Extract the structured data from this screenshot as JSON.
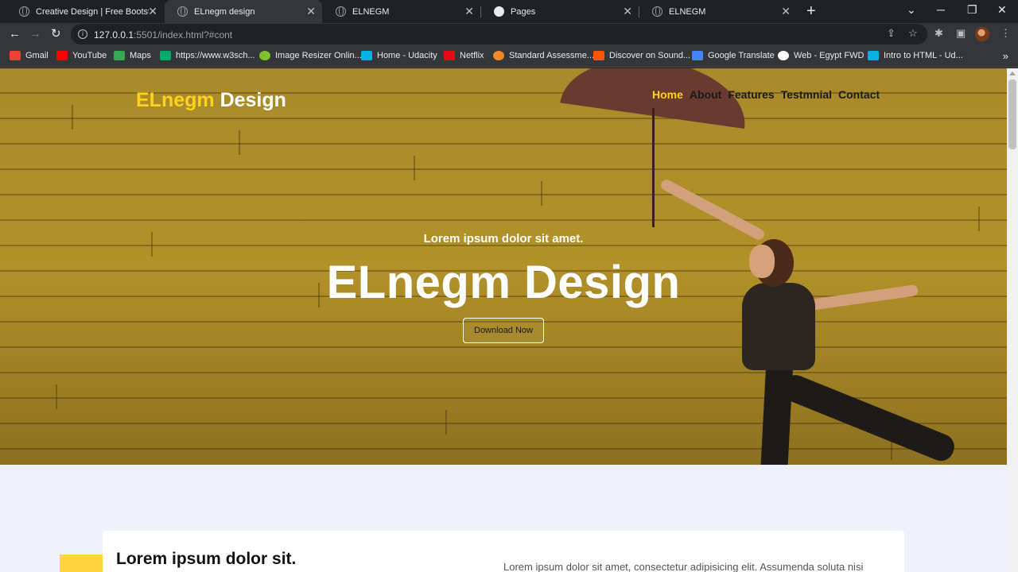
{
  "browser": {
    "tabs": [
      {
        "title": "Creative Design | Free Bootstrap",
        "active": false,
        "icon": "globe-icon"
      },
      {
        "title": "ELnegm design",
        "active": true,
        "icon": "globe-icon"
      },
      {
        "title": "ELNEGM",
        "active": false,
        "icon": "globe-icon"
      },
      {
        "title": "Pages",
        "active": false,
        "icon": "github-icon"
      },
      {
        "title": "ELNEGM",
        "active": false,
        "icon": "globe-icon"
      }
    ],
    "url_host": "127.0.0.1",
    "url_path": ":5501/index.html?#cont",
    "bookmarks": [
      {
        "label": "Gmail",
        "color": "#ea4335"
      },
      {
        "label": "YouTube",
        "color": "#ff0000"
      },
      {
        "label": "Maps",
        "color": "#34a853"
      },
      {
        "label": "https://www.w3sch...",
        "color": "#04aa6d"
      },
      {
        "label": "Image Resizer Onlin...",
        "color": "#7ec12b"
      },
      {
        "label": "Home - Udacity",
        "color": "#02b3e4"
      },
      {
        "label": "Netflix",
        "color": "#e50914"
      },
      {
        "label": "Standard Assessme...",
        "color": "#f08a24"
      },
      {
        "label": "Discover on Sound...",
        "color": "#ff5500"
      },
      {
        "label": "Google Translate",
        "color": "#4285f4"
      },
      {
        "label": "Web - Egypt FWD",
        "color": "#ffffff"
      },
      {
        "label": "Intro to HTML - Ud...",
        "color": "#02b3e4"
      }
    ]
  },
  "page": {
    "logo_accent": "ELnegm",
    "logo_rest": " Design",
    "nav": [
      {
        "label": "Home",
        "active": true
      },
      {
        "label": "About",
        "active": false
      },
      {
        "label": "Features",
        "active": false
      },
      {
        "label": "Testmnial",
        "active": false
      },
      {
        "label": "Contact",
        "active": false
      }
    ],
    "hero_subtitle": "Lorem ipsum dolor sit amet.",
    "hero_title": "ELnegm Design",
    "hero_button": "Download Now",
    "section_title": "Lorem ipsum dolor sit.",
    "section_text": "Lorem ipsum dolor sit amet, consectetur adipisicing elit. Assumenda soluta nisi"
  },
  "colors": {
    "accent": "#ffd11a",
    "hero_bg": "#b29128",
    "page_bg": "#eef1fb"
  }
}
